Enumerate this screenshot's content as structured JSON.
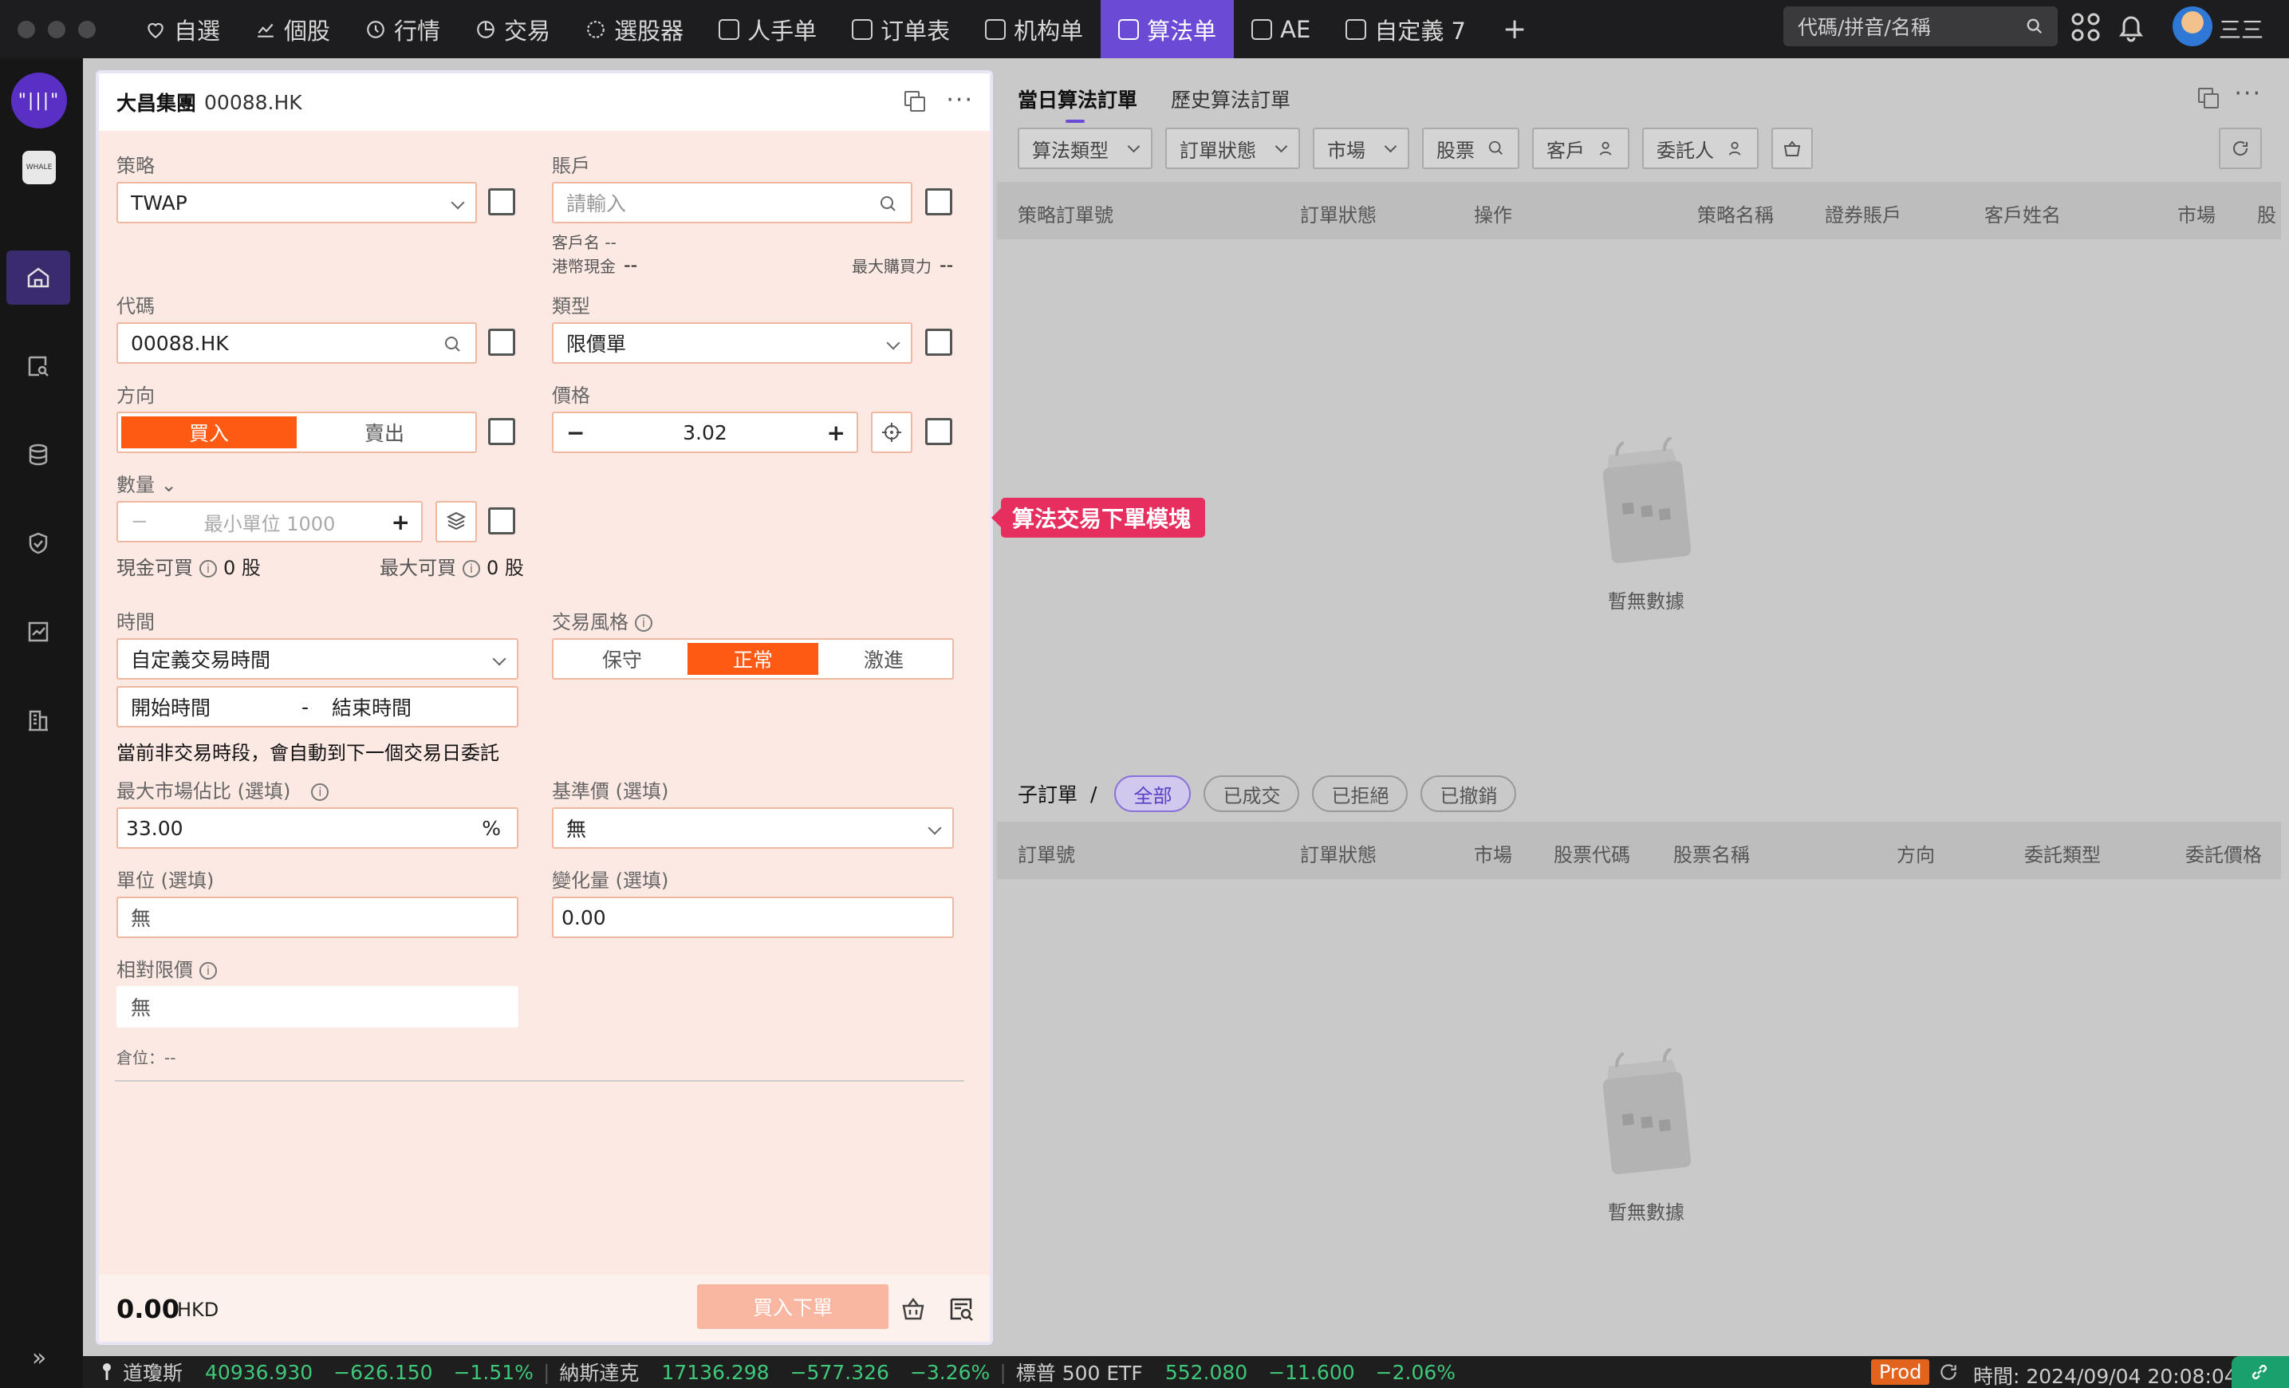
{
  "topnav": {
    "tabs": [
      {
        "label": "自選",
        "icon": "heart-icon"
      },
      {
        "label": "個股",
        "icon": "chart-line-icon"
      },
      {
        "label": "行情",
        "icon": "quote-icon"
      },
      {
        "label": "交易",
        "icon": "pie-icon"
      },
      {
        "label": "選股器",
        "icon": "screener-icon"
      },
      {
        "label": "人手单",
        "icon": "layout-icon"
      },
      {
        "label": "订单表",
        "icon": "layout-icon"
      },
      {
        "label": "机构单",
        "icon": "layout-icon"
      },
      {
        "label": "算法单",
        "icon": "layout-icon",
        "active": true
      },
      {
        "label": "AE",
        "icon": "layout-icon"
      },
      {
        "label": "自定義 7",
        "icon": "layout-icon"
      }
    ],
    "add_label": "+",
    "search_placeholder": "代碼/拼音/名稱",
    "user_menu": "三三",
    "accent_color": "#6b4bd6"
  },
  "sidebar": {
    "logo_text": "\"|||\"",
    "app_label": "WHALE"
  },
  "order": {
    "stock_name": "大昌集團",
    "stock_code": "00088.HK",
    "strategy_label": "策略",
    "strategy_value": "TWAP",
    "account_label": "賬戶",
    "account_placeholder": "請輸入",
    "client_name_label": "客戶名 --",
    "hkd_cash_label": "港幣現金",
    "hkd_cash_value": "--",
    "max_buying_label": "最大購買力",
    "max_buying_value": "--",
    "code_label": "代碼",
    "code_value": "00088.HK",
    "type_label": "類型",
    "type_value": "限價單",
    "direction_label": "方向",
    "buy_label": "買入",
    "sell_label": "賣出",
    "price_label": "價格",
    "price_minus": "−",
    "price_value": "3.02",
    "price_plus": "+",
    "qty_label": "數量",
    "qty_minus": "−",
    "qty_placeholder": "最小單位 1000",
    "qty_plus": "+",
    "cash_buyable_label": "現金可買",
    "cash_buyable_value": "0 股",
    "max_buyable_label": "最大可買",
    "max_buyable_value": "0 股",
    "time_label": "時間",
    "time_value": "自定義交易時間",
    "start_time": "開始時間",
    "time_sep": "-",
    "end_time": "結束時間",
    "non_trading_note": "當前非交易時段，會自動到下一個交易日委託",
    "style_label": "交易風格",
    "style_options": [
      "保守",
      "正常",
      "激進"
    ],
    "style_selected": "正常",
    "max_market_label": "最大市場佔比 (選填)",
    "max_market_value": "33.00",
    "max_market_unit": "%",
    "benchmark_label": "基準價 (選填)",
    "benchmark_value": "無",
    "unit_label": "單位 (選填)",
    "unit_value": "無",
    "change_label": "變化量 (選填)",
    "change_value": "0.00",
    "rel_limit_label": "相對限價",
    "rel_limit_value": "無",
    "position_label": "倉位：--",
    "total_amount": "0.00",
    "total_currency": "HKD",
    "submit_label": "買入下單",
    "buy_color": "#ff5a14"
  },
  "tooltip": {
    "text": "算法交易下單模塊",
    "color": "#e62e5f"
  },
  "right": {
    "tabs": [
      "當日算法訂單",
      "歷史算法訂單"
    ],
    "filters": [
      "算法類型",
      "訂單狀態",
      "市場",
      "股票",
      "客戶",
      "委託人"
    ],
    "columns": [
      "策略訂單號",
      "訂單狀態",
      "操作",
      "策略名稱",
      "證券賬戶",
      "客戶姓名",
      "市場",
      "股"
    ],
    "empty_text": "暫無數據",
    "sub_title": "子訂單",
    "sub_sep": "/",
    "sub_filters": [
      "全部",
      "已成交",
      "已拒絕",
      "已撤銷"
    ],
    "sub_columns": [
      "訂單號",
      "訂單狀態",
      "市場",
      "股票代碼",
      "股票名稱",
      "方向",
      "委託類型",
      "委託價格"
    ],
    "sub_empty_text": "暫無數據"
  },
  "status": {
    "indices": [
      {
        "name": "道瓊斯",
        "price": "40936.930",
        "change": "−626.150",
        "pct": "−1.51%"
      },
      {
        "name": "納斯達克",
        "price": "17136.298",
        "change": "−577.326",
        "pct": "−3.26%"
      },
      {
        "name": "標普 500 ETF",
        "price": "552.080",
        "change": "−11.600",
        "pct": "−2.06%"
      }
    ],
    "env": "Prod",
    "time_text": "時間: 2024/09/04 20:08:04",
    "down_color": "#3fc77a"
  }
}
